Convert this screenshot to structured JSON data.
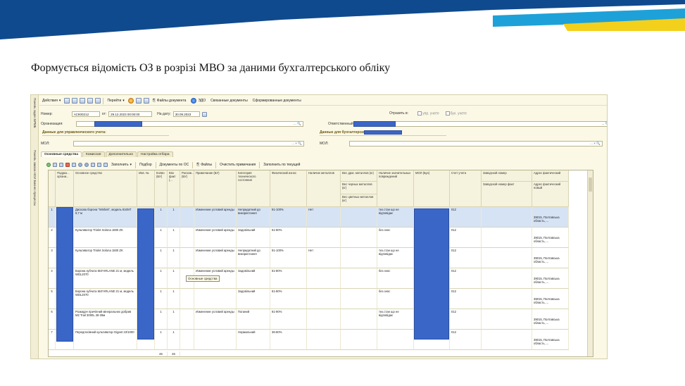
{
  "slide": {
    "title": "Формується відомість  ОЗ в розрізі МВО за даними бухгалтерського  обліку",
    "colors": {
      "banner_dark": "#0f4a8e",
      "banner_light": "#1ea1d8",
      "banner_yellow": "#f3d01c"
    }
  },
  "app": {
    "side_panel": {
      "label_1": "Панель задач БРМБ",
      "label_2": "Панель заказа НСИ  Бизнес-процессы"
    },
    "toolbar": {
      "actions": "Действия",
      "goto": "Перейти",
      "doc_files": "Файлы документа",
      "edo": "ЭДО",
      "linked_docs": "Связанные документы",
      "generated_docs": "Сформированные документы"
    },
    "header": {
      "number_label": "Номер:",
      "number_value": "АСК00212",
      "from_label": "от:",
      "from_value": "29.12.2023 00:00:00",
      "on_date_label": "На дату:",
      "on_date_value": "30.09.2023",
      "reflect_label": "Отразить в:",
      "mgmt_acc": "упр. учете",
      "buh_acc": "бух. учете",
      "org_label": "Организация:",
      "resp_label": "Ответственный:",
      "mgmt_section": "Данные для управленческого учета:",
      "buh_section": "Данные для бухгалтерского учета:",
      "mol_label_left": "МОЛ:",
      "mol_label_right": "МОЛ:"
    },
    "tabs": [
      {
        "label": "Основные средства",
        "active": true
      },
      {
        "label": "Комиссия",
        "active": false
      },
      {
        "label": "Дополнительно",
        "active": false
      },
      {
        "label": "Настройка отбора",
        "active": false
      }
    ],
    "subtoolbar": {
      "fill": "Заполнить",
      "pick": "Подбор",
      "docs_os": "Документы по ОС",
      "files": "Файлы",
      "clear_notes": "Очистить примечания",
      "fill_current": "Заполнить по текущей"
    },
    "grid": {
      "columns": [
        "Подраз... органи...",
        "Основное средство",
        "Инв. №",
        "Колво (БУ)",
        "Кво факт (...",
        "Расхож... (БУ)",
        "Примечание (БУ)",
        "Категория технического состояния",
        "Физический износ",
        "Наличие металлов",
        "Вес драг. металлов (кг)",
        "Наличие значительных повреждений",
        "МОЛ (Бух)",
        "Счет учета",
        "Заводской номер",
        "Адрес фактический"
      ],
      "subheaders": {
        "metals_black": "Вес черных металлов (кг)",
        "metals_color": "Вес цветных металлов (кг)",
        "factory_fact": "Заводской номер факт",
        "address_new": "Адрес фактический новый"
      },
      "rows": [
        {
          "n": "1",
          "asset": "Дискова борона \"Wishek\", модель 816NT 6,7 м",
          "qty": "1",
          "fact": "1",
          "note": "Изменение условий аренды",
          "cat": "Непридатний до використання",
          "wear": "91-100%",
          "metal": "Нет",
          "damage": "тех.стан що не відповідає",
          "acc": "012",
          "addr": "39015, Полтавська область, ..."
        },
        {
          "n": "2",
          "asset": "Культиватор Triolet Solona  1800 ZK",
          "qty": "1",
          "fact": "1",
          "note": "Изменение условий аренды",
          "cat": "Задовільний",
          "wear": "61-80%",
          "metal": "",
          "damage": "без знос",
          "acc": "012",
          "addr": "39015, Полтавська область, ..."
        },
        {
          "n": "3",
          "asset": "Культиватор Triolet Solona  1500 ZK",
          "qty": "1",
          "fact": "1",
          "note": "Изменение условий аренды",
          "cat": "Непридатний до використання",
          "wear": "91-100%",
          "metal": "Нет",
          "damage": "тех.стан що не відповідає",
          "acc": "012",
          "addr": "39015, Полтавська область, ..."
        },
        {
          "n": "4",
          "asset": "Борона зубчата McFARLANE 21 м, модель WDL2070",
          "qty": "1",
          "fact": "1",
          "note": "Изменение условий аренды",
          "cat": "Задовільний",
          "wear": "61-80%",
          "metal": "",
          "damage": "без знос",
          "acc": "012",
          "addr": "39015, Полтавська область, ..."
        },
        {
          "n": "5",
          "asset": "Борона зубчата McFARLANE 21 м, модель WDL2070",
          "qty": "1",
          "fact": "1",
          "note": "",
          "cat": "Задовільний",
          "wear": "61-80%",
          "metal": "",
          "damage": "без знос",
          "acc": "012",
          "addr": "39015, Полтавська область, ..."
        },
        {
          "n": "6",
          "asset": "Розкидач причіпний мінеральних добрив M2 Trail 3000L 28-39м",
          "qty": "1",
          "fact": "1",
          "note": "Изменение условий аренды",
          "cat": "Поганий",
          "wear": "81-90%",
          "metal": "",
          "damage": "тех.стан що не відповідає",
          "acc": "012",
          "addr": "39015, Полтавська область, ..."
        },
        {
          "n": "7",
          "asset": "Передпосівний культиватор Gigant 10/1000",
          "qty": "1",
          "fact": "1",
          "note": "",
          "cat": "Нормальний",
          "wear": "36-60%",
          "metal": "",
          "damage": "",
          "acc": "012",
          "addr": "39015, Полтавська область, ..."
        }
      ],
      "totals": {
        "qty": "46",
        "fact": "46"
      },
      "tooltip": "Основные средства"
    }
  }
}
